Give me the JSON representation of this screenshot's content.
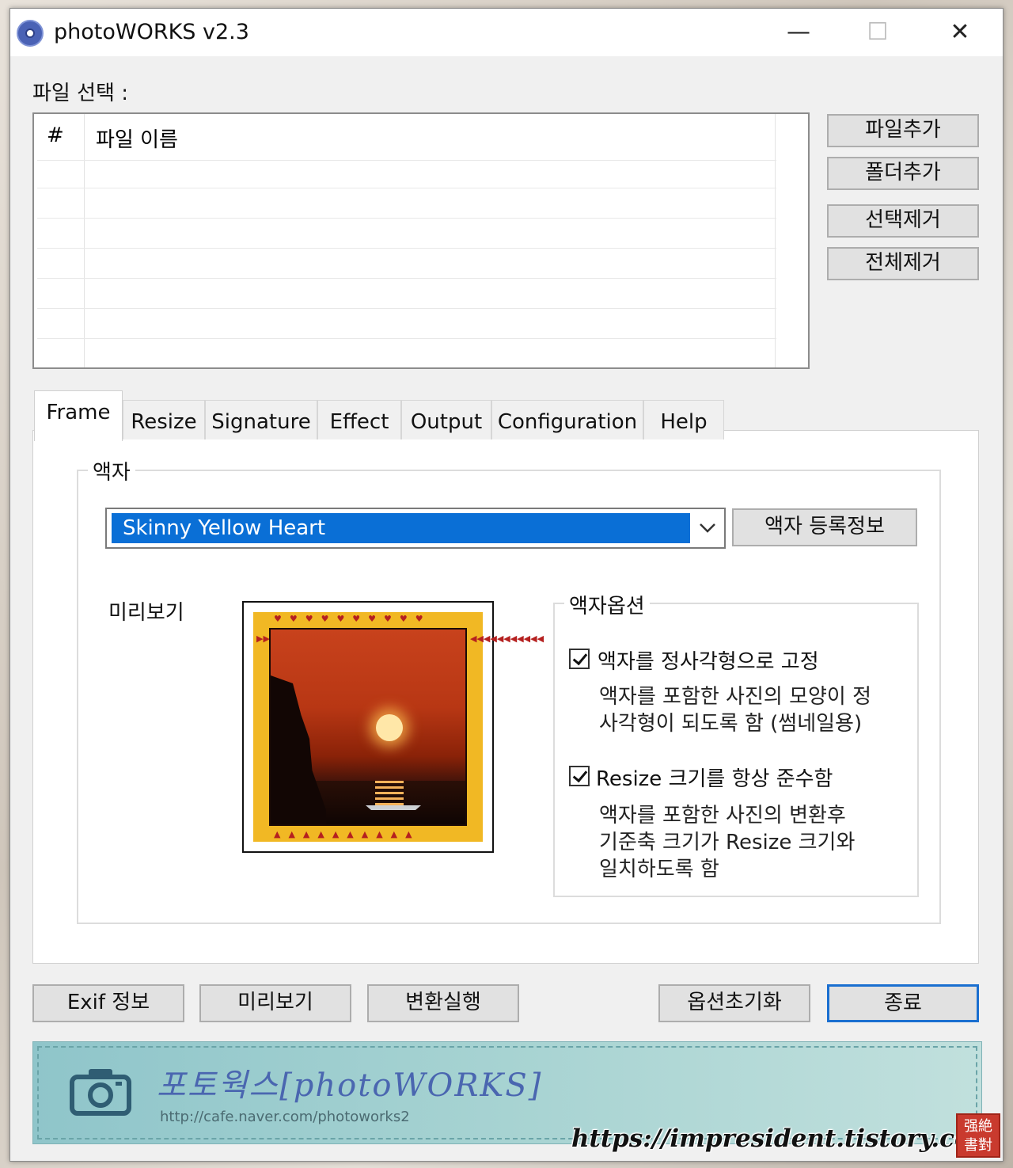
{
  "window": {
    "title": "photoWORKS v2.3"
  },
  "file_section": {
    "label": "파일 선택 :",
    "columns": [
      "#",
      "파일 이름"
    ]
  },
  "side_buttons": [
    "파일추가",
    "폴더추가",
    "선택제거",
    "전체제거"
  ],
  "tabs": [
    "Frame",
    "Resize",
    "Signature",
    "Effect",
    "Output",
    "Configuration",
    "Help"
  ],
  "active_tab": "Frame",
  "frame_tab": {
    "group_title": "액자",
    "frame_select_value": "Skinny Yellow Heart",
    "register_button": "액자 등록정보",
    "preview_label": "미리보기",
    "options_title": "액자옵션",
    "option1": {
      "label": "액자를 정사각형으로 고정",
      "checked": true,
      "desc_line1": "액자를 포함한 사진의 모양이 정",
      "desc_line2": "사각형이 되도록 함 (썸네일용)"
    },
    "option2": {
      "label": "Resize 크기를 항상 준수함",
      "checked": true,
      "desc_line1": "액자를 포함한 사진의 변환후",
      "desc_line2": "기준축 크기가 Resize 크기와",
      "desc_line3": "일치하도록 함"
    }
  },
  "bottom_buttons": {
    "exif": "Exif 정보",
    "preview": "미리보기",
    "convert": "변환실행",
    "reset": "옵션초기화",
    "exit": "종료"
  },
  "banner": {
    "title": "포토웍스[photoWORKS]",
    "url": "http://cafe.naver.com/photoworks2"
  },
  "watermark": {
    "text": "https://impresident.tistory.com",
    "seal_text": "强絶 書對"
  },
  "colors": {
    "selection": "#0a6fd6",
    "default_button_border": "#1a6fd0",
    "banner": "#a7d3d2"
  }
}
